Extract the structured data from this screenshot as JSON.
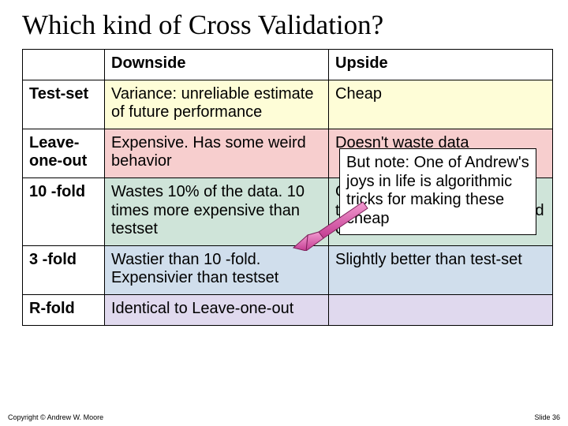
{
  "title": "Which kind of Cross Validation?",
  "headers": {
    "col0": "",
    "col1": "Downside",
    "col2": "Upside"
  },
  "rows": {
    "testset": {
      "label": "Test-set",
      "downside": "Variance: unreliable estimate of future performance",
      "upside": "Cheap"
    },
    "loo": {
      "label": "Leave-one-out",
      "downside": "Expensive.\nHas some weird behavior",
      "upside": "Doesn't waste data"
    },
    "tenfold": {
      "label": "10 -fold",
      "downside": "Wastes 10% of the data.\n10 times more expensive than testset",
      "upside": "Only wastes 10%. Only 10 times more expensive instead of R times."
    },
    "threefold": {
      "label": "3 -fold",
      "downside": "Wastier than 10 -fold. Expensivier than testset",
      "upside": "Slightly better than test-set"
    },
    "rfold": {
      "label": "R-fold",
      "downside": "Identical to Leave-one-out",
      "upside": ""
    }
  },
  "callout": "But note: One of Andrew's joys in life is algorithmic tricks for making these cheap",
  "footer": {
    "copyright": "Copyright © Andrew W. Moore",
    "slide": "Slide 36"
  }
}
